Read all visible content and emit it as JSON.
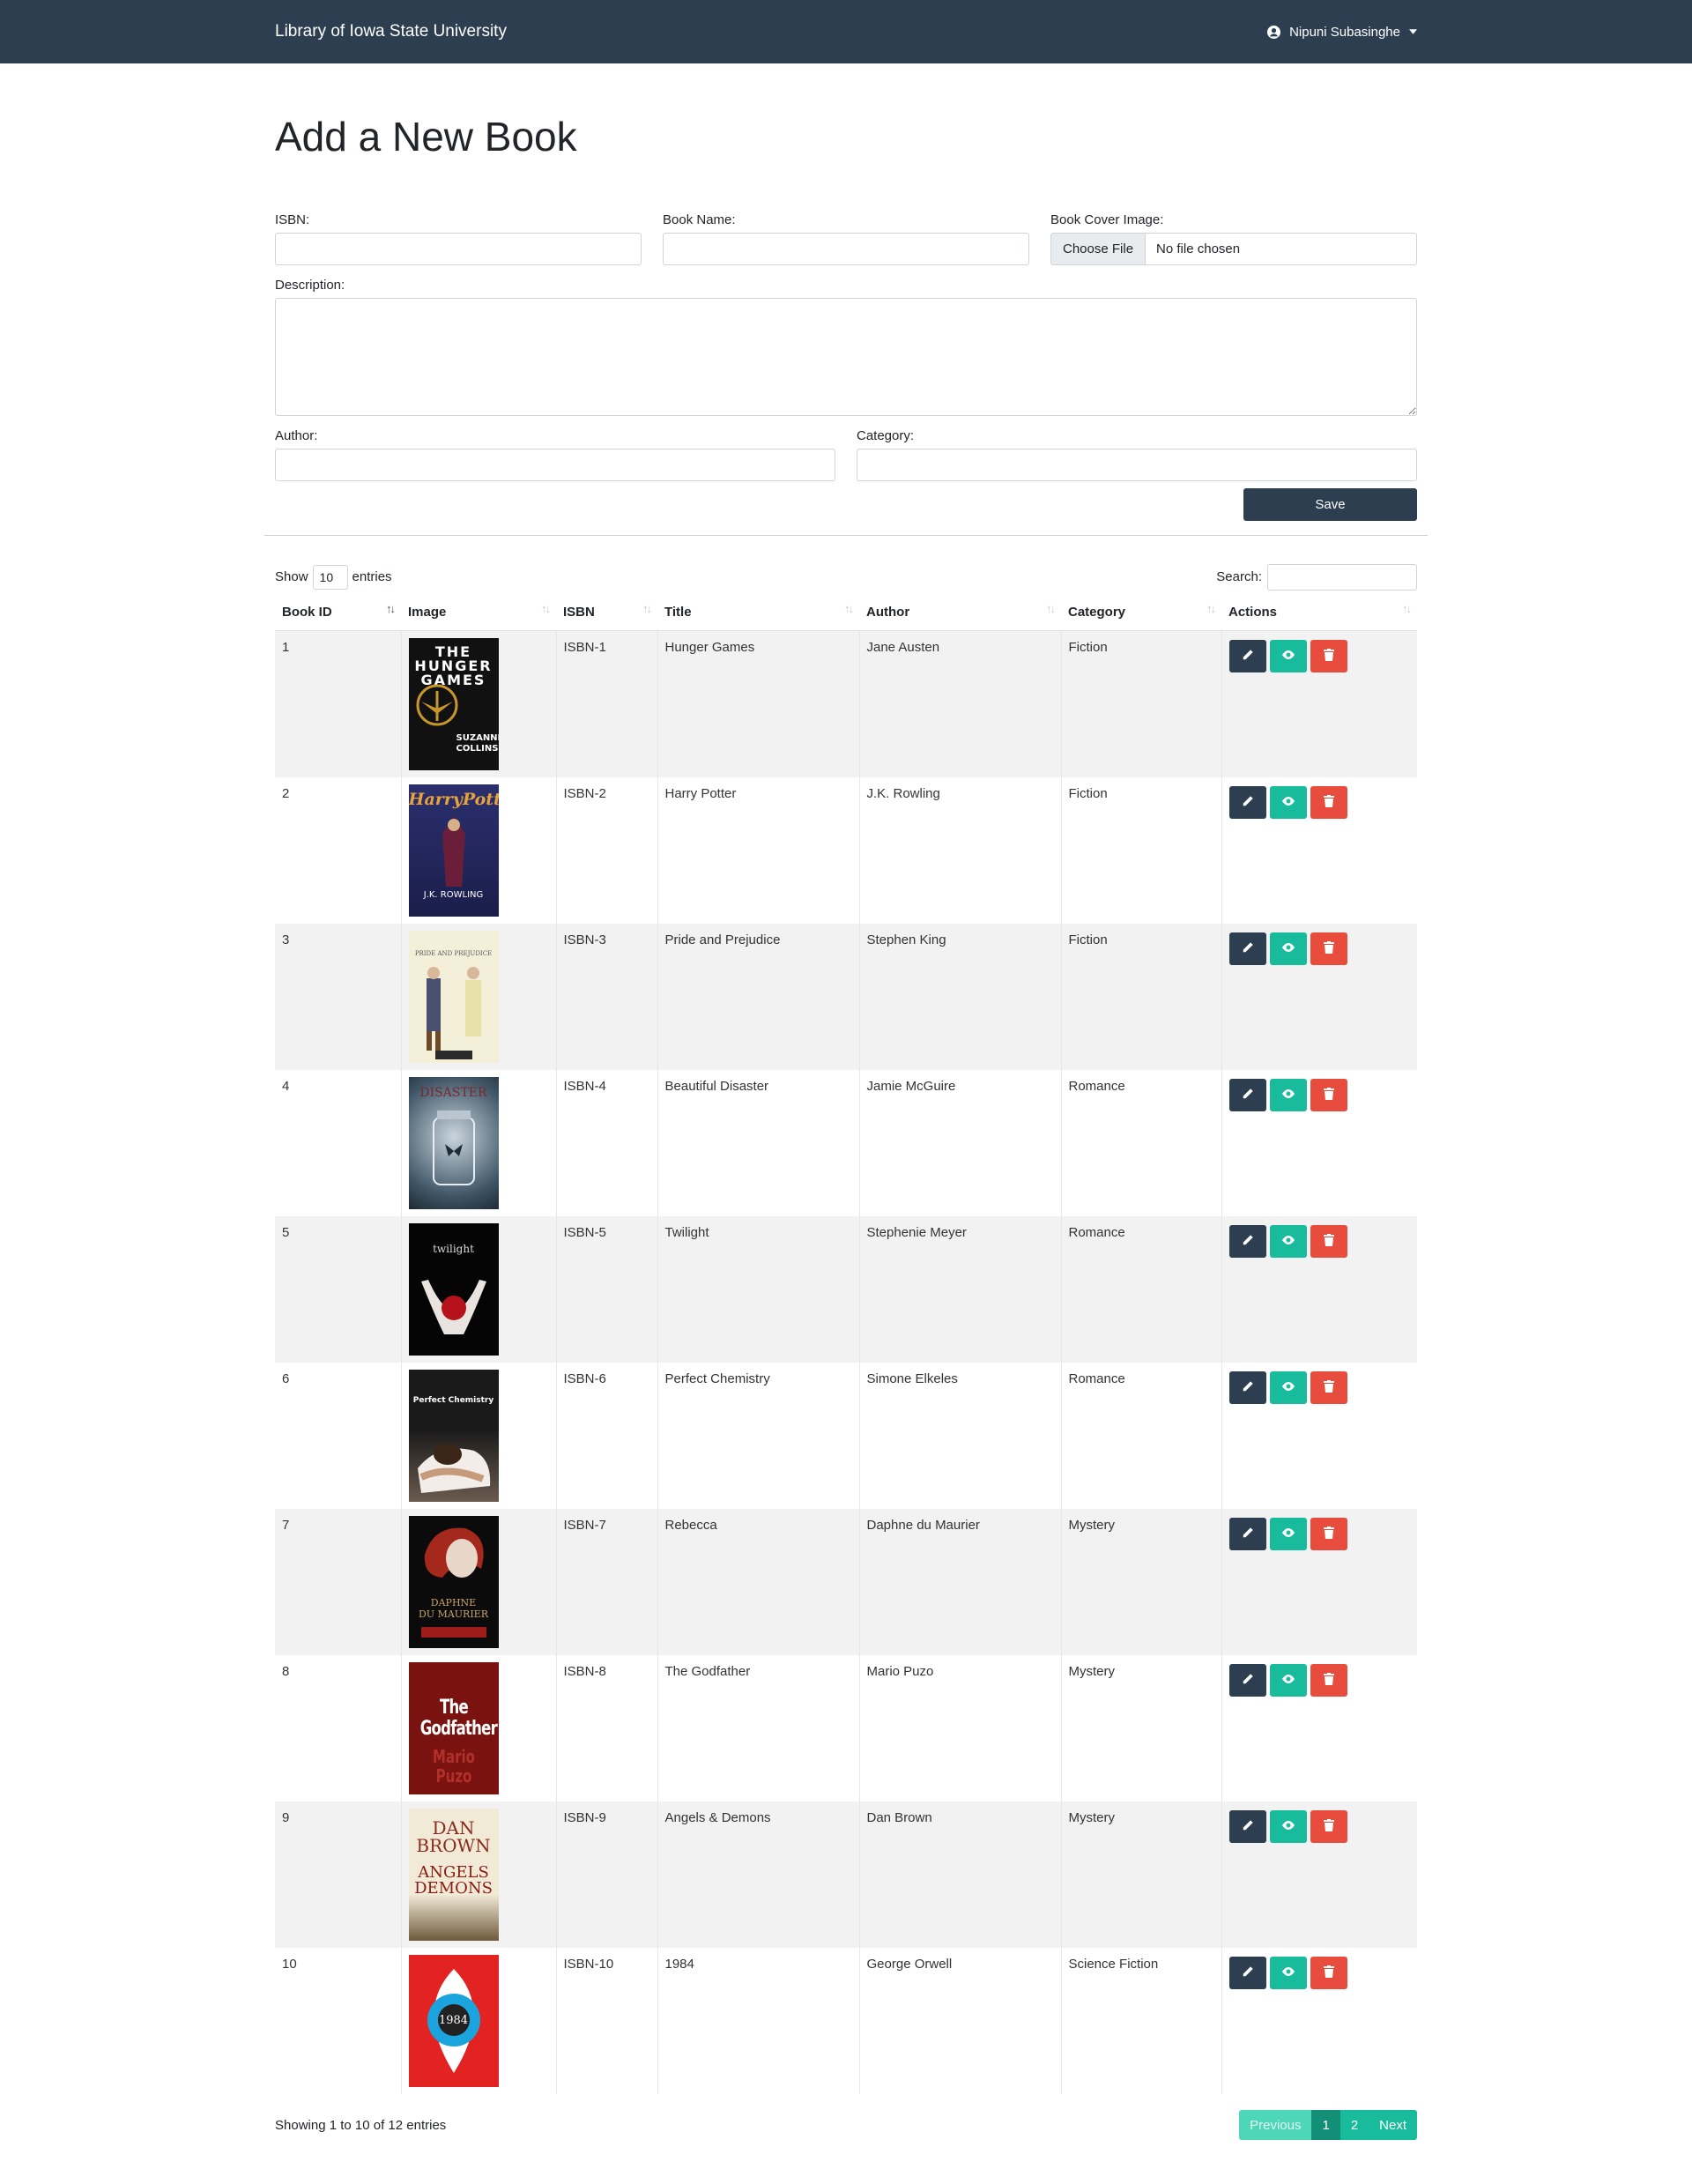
{
  "navbar": {
    "brand": "Library of Iowa State University",
    "user": "Nipuni Subasinghe"
  },
  "form": {
    "title": "Add a New Book",
    "isbn_label": "ISBN:",
    "name_label": "Book Name:",
    "cover_label": "Book Cover Image:",
    "choose_file": "Choose File",
    "no_file": "No file chosen",
    "description_label": "Description:",
    "author_label": "Author:",
    "category_label": "Category:",
    "save": "Save"
  },
  "table_controls": {
    "show": "Show",
    "entries_value": "10",
    "entries": "entries",
    "search": "Search:"
  },
  "columns": [
    "Book ID",
    "Image",
    "ISBN",
    "Title",
    "Author",
    "Category",
    "Actions"
  ],
  "rows": [
    {
      "id": "1",
      "isbn": "ISBN-1",
      "title": "Hunger Games",
      "author": "Jane Austen",
      "category": "Fiction"
    },
    {
      "id": "2",
      "isbn": "ISBN-2",
      "title": "Harry Potter",
      "author": "J.K. Rowling",
      "category": "Fiction"
    },
    {
      "id": "3",
      "isbn": "ISBN-3",
      "title": "Pride and Prejudice",
      "author": "Stephen King",
      "category": "Fiction"
    },
    {
      "id": "4",
      "isbn": "ISBN-4",
      "title": "Beautiful Disaster",
      "author": "Jamie McGuire",
      "category": "Romance"
    },
    {
      "id": "5",
      "isbn": "ISBN-5",
      "title": "Twilight",
      "author": "Stephenie Meyer",
      "category": "Romance"
    },
    {
      "id": "6",
      "isbn": "ISBN-6",
      "title": "Perfect Chemistry",
      "author": "Simone Elkeles",
      "category": "Romance"
    },
    {
      "id": "7",
      "isbn": "ISBN-7",
      "title": "Rebecca",
      "author": "Daphne du Maurier",
      "category": "Mystery"
    },
    {
      "id": "8",
      "isbn": "ISBN-8",
      "title": "The Godfather",
      "author": "Mario Puzo",
      "category": "Mystery"
    },
    {
      "id": "9",
      "isbn": "ISBN-9",
      "title": "Angels & Demons",
      "author": "Dan Brown",
      "category": "Mystery"
    },
    {
      "id": "10",
      "isbn": "ISBN-10",
      "title": "1984",
      "author": "George Orwell",
      "category": "Science Fiction"
    }
  ],
  "footer": {
    "info": "Showing 1 to 10 of 12 entries",
    "previous": "Previous",
    "page1": "1",
    "page2": "2",
    "next": "Next"
  },
  "colors": {
    "navbar": "#2c3e50",
    "edit": "#2c3e50",
    "view": "#18bc9c",
    "delete": "#e74c3c"
  },
  "icons": {
    "user": "user-circle-icon",
    "caret": "caret-down-icon",
    "edit": "pencil-icon",
    "view": "eye-icon",
    "delete": "trash-icon"
  }
}
